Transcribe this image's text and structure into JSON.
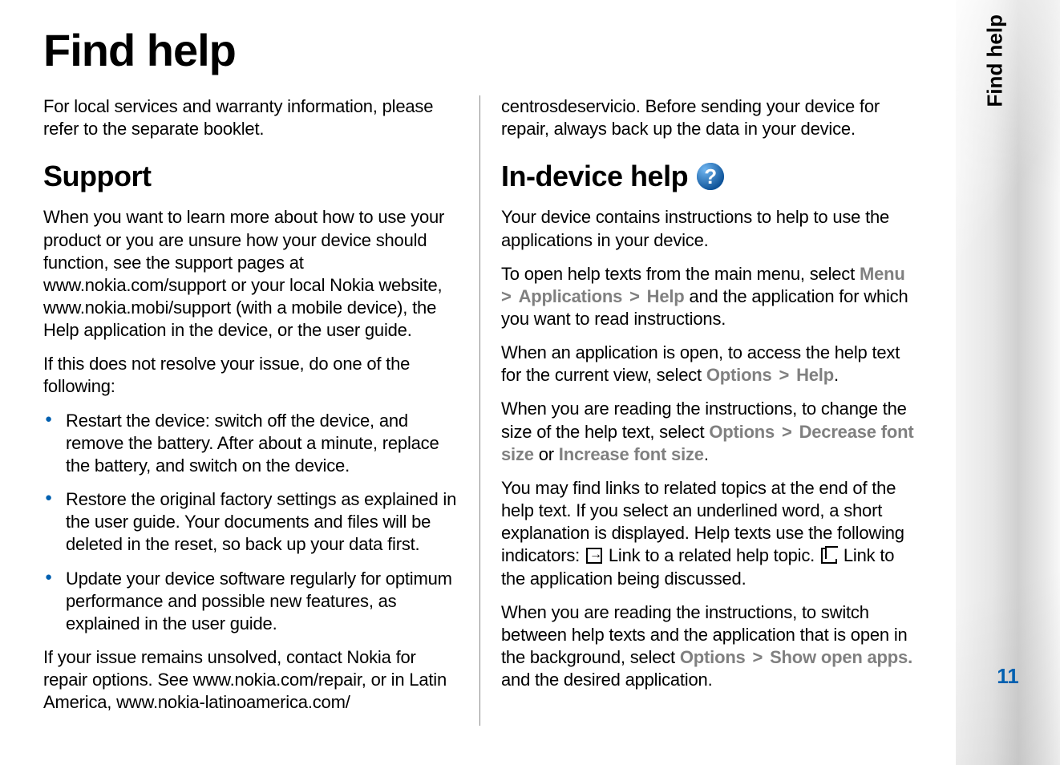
{
  "page": {
    "title": "Find help",
    "sidebar_title": "Find help",
    "number": "11"
  },
  "intro": "For local services and warranty information, please refer to the separate booklet.",
  "support": {
    "heading": "Support",
    "p1": "When you want to learn more about how to use your product or you are unsure how your device should function, see the support pages at www.nokia.com/support or your local Nokia website, www.nokia.mobi/support (with a mobile device), the Help application in the device, or the user guide.",
    "p2": "If this does not resolve your issue, do one of the following:",
    "bullets": [
      "Restart the device: switch off the device, and remove the battery. After about a minute, replace the battery, and switch on the device.",
      "Restore the original factory settings as explained in the user guide. Your documents and files will be deleted in the reset, so back up your data first.",
      "Update your device software regularly for optimum performance and possible new features, as explained in the user guide."
    ],
    "p3": "If your issue remains unsolved, contact Nokia for repair options. See www.nokia.com/repair, or in Latin America, www.nokia-latinoamerica.com/"
  },
  "col2_top": "centrosdeservicio. Before sending your device for repair, always back up the data in your device.",
  "indevice": {
    "heading": "In-device help",
    "p1": "Your device contains instructions to help to use the applications in your device.",
    "p2a": "To open help texts from the main menu, select ",
    "menu": "Menu",
    "applications": "Applications",
    "help": "Help",
    "p2b": " and the application for which you want to read instructions.",
    "p3a": "When an application is open, to access the help text for the current view, select ",
    "options": "Options",
    "p3b": ".",
    "p4a": "When you are reading the instructions, to change the size of the help text, select ",
    "decrease": "Decrease font size",
    "or": " or ",
    "increase": "Increase font size",
    "p4b": ".",
    "p5a": "You may find links to related topics at the end of the help text. If you select an underlined word, a short explanation is displayed. Help texts use the following indicators: ",
    "p5b": " Link to a related help topic. ",
    "p5c": " Link to the application being discussed.",
    "p6a": "When you are reading the instructions, to switch between help texts and the application that is open in the background, select ",
    "showopen": "Show open apps.",
    "p6b": " and the desired application."
  }
}
